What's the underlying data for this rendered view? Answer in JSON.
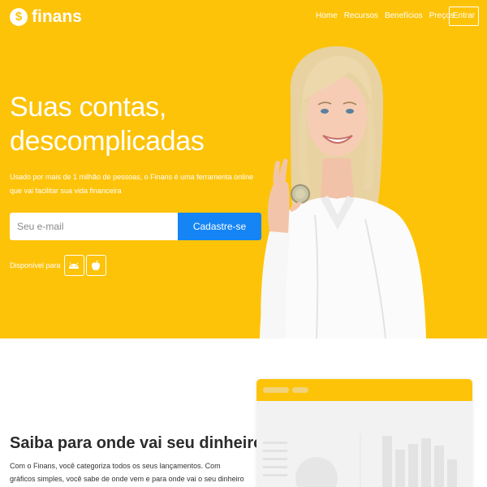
{
  "brand": {
    "name": "finans",
    "mark": "$"
  },
  "nav": {
    "items": [
      "Home",
      "Recursos",
      "Benefícios",
      "Preços"
    ],
    "login_label": "Entrar"
  },
  "hero": {
    "title_line1": "Suas contas,",
    "title_line2": "descomplicadas",
    "subtitle": "Usado por mais de 1 milhão de pessoas, o Finans é uma ferramenta online que vai facilitar sua vida financeira",
    "email_placeholder": "Seu e-mail",
    "signup_label": "Cadastre-se",
    "available_label": "Disponível para",
    "stores": [
      "android-icon",
      "apple-icon"
    ]
  },
  "feature": {
    "title": "Saiba para onde vai seu dinheiro",
    "text": "Com o Finans, você categoriza todos os seus lançamentos. Com gráficos simples, você sabe de onde vem e para onde vai o seu dinheiro"
  },
  "colors": {
    "primary": "#fdc309",
    "button": "#1585f6",
    "text": "#2b2b2b"
  }
}
